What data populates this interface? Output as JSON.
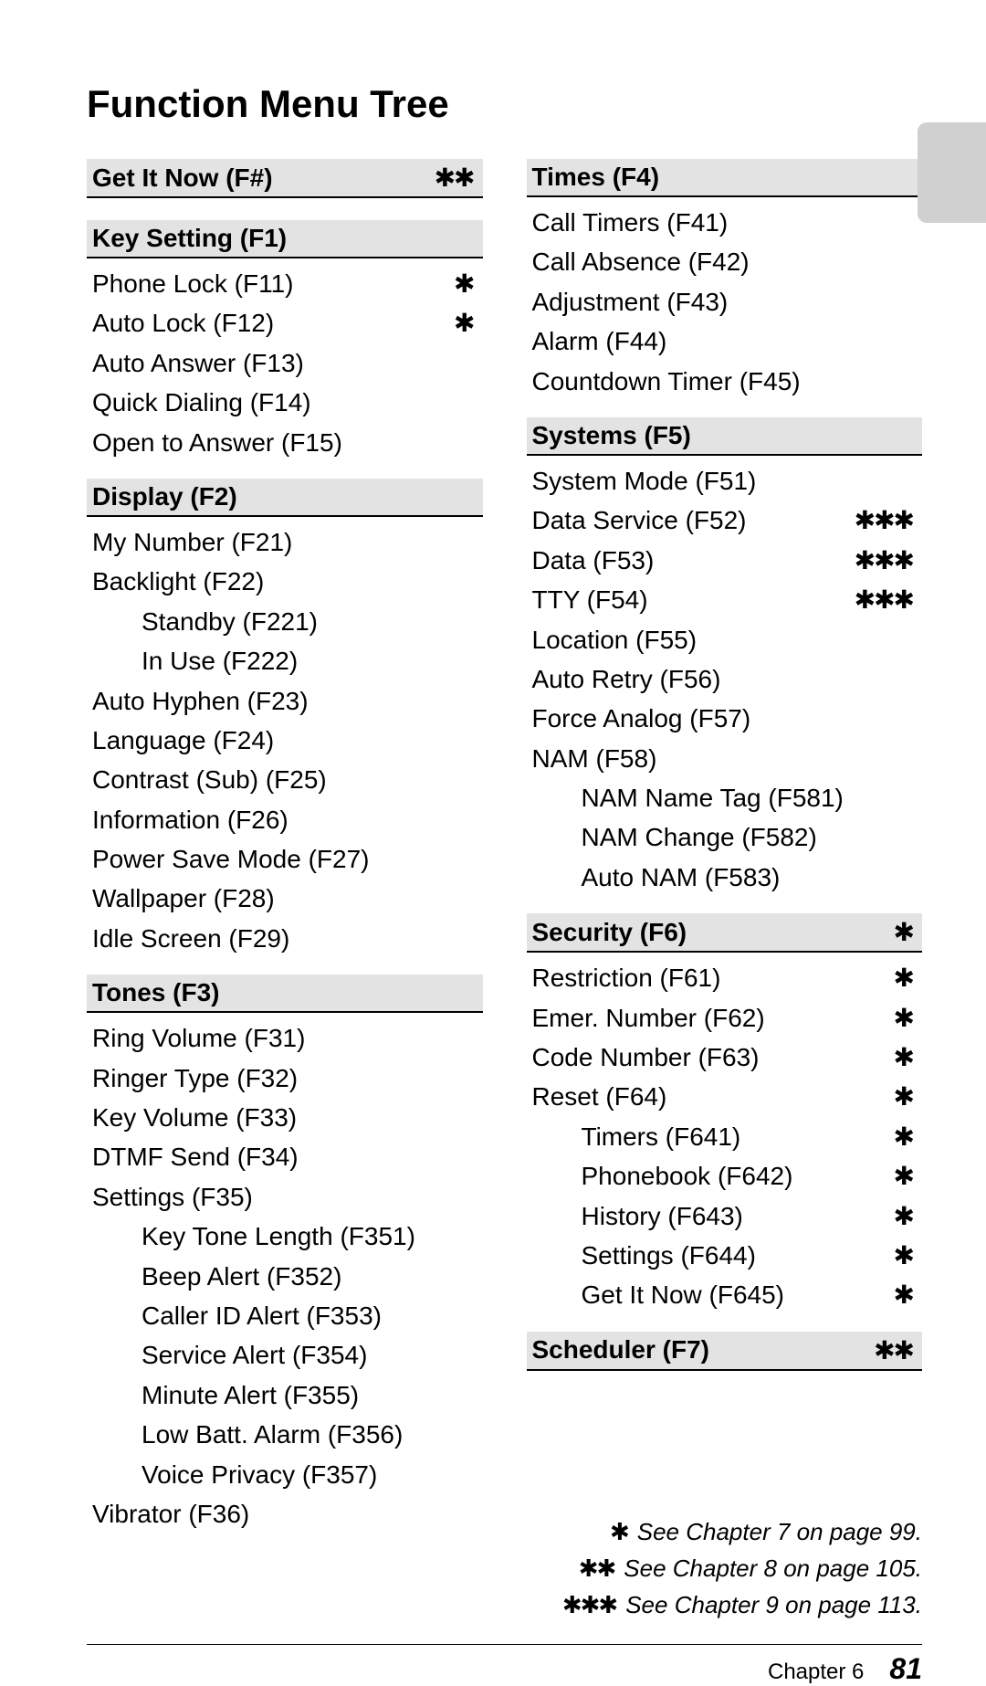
{
  "star1": "✱",
  "star2": "✱✱",
  "star3": "✱✱✱",
  "title": "Function Menu Tree",
  "left": [
    {
      "type": "head",
      "label": "Get It Now (F#)",
      "stars": 2
    },
    {
      "type": "head",
      "label": "Key Setting (F1)"
    },
    {
      "type": "item",
      "label": "Phone Lock (F11)",
      "stars": 1
    },
    {
      "type": "item",
      "label": "Auto Lock (F12)",
      "stars": 1
    },
    {
      "type": "item",
      "label": "Auto Answer (F13)"
    },
    {
      "type": "item",
      "label": "Quick Dialing (F14)"
    },
    {
      "type": "item",
      "label": "Open to Answer (F15)"
    },
    {
      "type": "head",
      "label": "Display (F2)"
    },
    {
      "type": "item",
      "label": "My Number (F21)"
    },
    {
      "type": "item",
      "label": "Backlight (F22)"
    },
    {
      "type": "item",
      "label": "Standby (F221)",
      "indent": true
    },
    {
      "type": "item",
      "label": "In Use (F222)",
      "indent": true
    },
    {
      "type": "item",
      "label": "Auto Hyphen (F23)"
    },
    {
      "type": "item",
      "label": "Language (F24)"
    },
    {
      "type": "item",
      "label": "Contrast (Sub) (F25)"
    },
    {
      "type": "item",
      "label": "Information (F26)"
    },
    {
      "type": "item",
      "label": "Power Save Mode (F27)"
    },
    {
      "type": "item",
      "label": "Wallpaper (F28)"
    },
    {
      "type": "item",
      "label": "Idle Screen (F29)"
    },
    {
      "type": "head",
      "label": "Tones (F3)"
    },
    {
      "type": "item",
      "label": "Ring Volume (F31)"
    },
    {
      "type": "item",
      "label": "Ringer Type (F32)"
    },
    {
      "type": "item",
      "label": "Key Volume (F33)"
    },
    {
      "type": "item",
      "label": "DTMF Send (F34)"
    },
    {
      "type": "item",
      "label": "Settings (F35)"
    },
    {
      "type": "item",
      "label": "Key Tone Length (F351)",
      "indent": true
    },
    {
      "type": "item",
      "label": "Beep Alert (F352)",
      "indent": true
    },
    {
      "type": "item",
      "label": "Caller ID Alert (F353)",
      "indent": true
    },
    {
      "type": "item",
      "label": "Service Alert (F354)",
      "indent": true
    },
    {
      "type": "item",
      "label": "Minute Alert (F355)",
      "indent": true
    },
    {
      "type": "item",
      "label": "Low Batt. Alarm (F356)",
      "indent": true
    },
    {
      "type": "item",
      "label": "Voice Privacy (F357)",
      "indent": true
    },
    {
      "type": "item",
      "label": "Vibrator (F36)"
    }
  ],
  "right": [
    {
      "type": "head",
      "label": "Times (F4)"
    },
    {
      "type": "item",
      "label": "Call Timers (F41)"
    },
    {
      "type": "item",
      "label": "Call Absence (F42)"
    },
    {
      "type": "item",
      "label": "Adjustment (F43)"
    },
    {
      "type": "item",
      "label": "Alarm (F44)"
    },
    {
      "type": "item",
      "label": "Countdown Timer (F45)"
    },
    {
      "type": "head",
      "label": "Systems (F5)"
    },
    {
      "type": "item",
      "label": "System Mode (F51)"
    },
    {
      "type": "item",
      "label": "Data Service (F52)",
      "stars": 3
    },
    {
      "type": "item",
      "label": "Data (F53)",
      "stars": 3
    },
    {
      "type": "item",
      "label": "TTY (F54)",
      "stars": 3
    },
    {
      "type": "item",
      "label": "Location (F55)"
    },
    {
      "type": "item",
      "label": "Auto Retry (F56)"
    },
    {
      "type": "item",
      "label": "Force Analog (F57)"
    },
    {
      "type": "item",
      "label": "NAM (F58)"
    },
    {
      "type": "item",
      "label": "NAM Name Tag (F581)",
      "indent": true
    },
    {
      "type": "item",
      "label": "NAM Change (F582)",
      "indent": true
    },
    {
      "type": "item",
      "label": "Auto NAM (F583)",
      "indent": true
    },
    {
      "type": "head",
      "label": "Security (F6)",
      "stars": 1
    },
    {
      "type": "item",
      "label": "Restriction (F61)",
      "stars": 1
    },
    {
      "type": "item",
      "label": "Emer. Number (F62)",
      "stars": 1
    },
    {
      "type": "item",
      "label": "Code Number (F63)",
      "stars": 1
    },
    {
      "type": "item",
      "label": "Reset (F64)",
      "stars": 1
    },
    {
      "type": "item",
      "label": "Timers (F641)",
      "stars": 1,
      "indent": true
    },
    {
      "type": "item",
      "label": "Phonebook (F642)",
      "stars": 1,
      "indent": true
    },
    {
      "type": "item",
      "label": "History (F643)",
      "stars": 1,
      "indent": true
    },
    {
      "type": "item",
      "label": "Settings (F644)",
      "stars": 1,
      "indent": true
    },
    {
      "type": "item",
      "label": "Get It Now (F645)",
      "stars": 1,
      "indent": true
    },
    {
      "type": "head",
      "label": "Scheduler (F7)",
      "stars": 2
    }
  ],
  "notes": [
    {
      "sym": 1,
      "text": "See Chapter 7 on page 99."
    },
    {
      "sym": 2,
      "text": "See Chapter 8 on page 105."
    },
    {
      "sym": 3,
      "text": "See Chapter 9 on page 113."
    }
  ],
  "footer": {
    "chapter": "Chapter 6",
    "page": "81"
  }
}
